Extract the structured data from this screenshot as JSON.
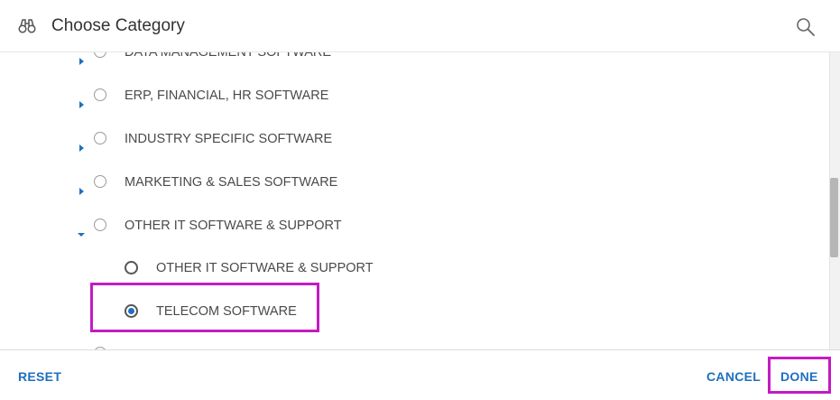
{
  "header": {
    "title": "Choose Category",
    "left_icon": "binoculars-icon",
    "right_icon": "search-icon"
  },
  "list": {
    "items": [
      {
        "label": "DATA MANAGEMENT SOFTWARE",
        "expanded": false,
        "level": 0
      },
      {
        "label": "ERP, FINANCIAL, HR SOFTWARE",
        "expanded": false,
        "level": 0
      },
      {
        "label": "INDUSTRY SPECIFIC SOFTWARE",
        "expanded": false,
        "level": 0
      },
      {
        "label": "MARKETING & SALES SOFTWARE",
        "expanded": false,
        "level": 0
      },
      {
        "label": "OTHER IT SOFTWARE & SUPPORT",
        "expanded": true,
        "level": 0
      },
      {
        "label": "OTHER IT SOFTWARE & SUPPORT",
        "level": 1,
        "selected": false
      },
      {
        "label": "TELECOM SOFTWARE",
        "level": 1,
        "selected": true
      }
    ]
  },
  "footer": {
    "reset_label": "RESET",
    "cancel_label": "CANCEL",
    "done_label": "DONE"
  },
  "colors": {
    "accent": "#1f6fbf",
    "highlight": "#c21bc2"
  }
}
